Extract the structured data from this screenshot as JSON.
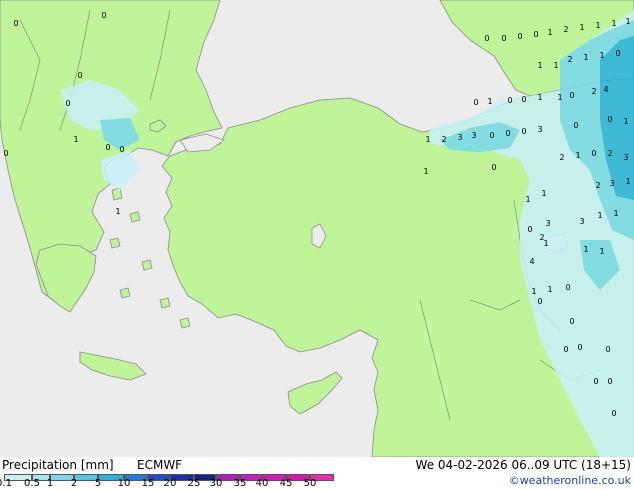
{
  "footer": {
    "title": "Precipitation [mm]",
    "model": "ECMWF",
    "datetime": "We 04-02-2026 06..09 UTC (18+15)",
    "credit": "©weatheronline.co.uk"
  },
  "legend": {
    "ticks": [
      "0.1",
      "0.5",
      "1",
      "2",
      "5",
      "10",
      "15",
      "20",
      "25",
      "30",
      "35",
      "40",
      "45",
      "50"
    ],
    "colors": [
      "#c8f0f8",
      "#a0e6f4",
      "#78d8ee",
      "#50c8e8",
      "#28b0e0",
      "#1e7ed6",
      "#1c50c8",
      "#1830a8",
      "#122090",
      "#b020c0",
      "#c818c8",
      "#d818c0",
      "#e010b8",
      "#e82cb0"
    ]
  },
  "colors": {
    "land": "#bff598",
    "sea": "#ececec",
    "border": "#8a8a8a",
    "precip_light": "#c8f0f8",
    "precip_mid": "#78d8ee",
    "precip_heavy": "#28b0e0"
  },
  "map_values": [
    "0",
    "0",
    "0",
    "0",
    "1",
    "2",
    "1",
    "1",
    "1",
    "1",
    "1",
    "1",
    "2",
    "1",
    "1",
    "0",
    "4",
    "2",
    "0",
    "1",
    "1",
    "0",
    "0",
    "0",
    "1",
    "2",
    "1",
    "3",
    "3",
    "0",
    "0",
    "0",
    "3",
    "0",
    "0",
    "1",
    "0",
    "1",
    "2",
    "1",
    "0",
    "2",
    "3",
    "2",
    "3",
    "1",
    "1",
    "1",
    "0",
    "2",
    "3",
    "1",
    "1",
    "3",
    "1",
    "1",
    "1",
    "4",
    "1",
    "1",
    "0",
    "0",
    "0",
    "0",
    "0",
    "0",
    "0",
    "0",
    "0",
    "0",
    "0",
    "0",
    "0",
    "0",
    "0",
    "1",
    "1",
    "0"
  ]
}
